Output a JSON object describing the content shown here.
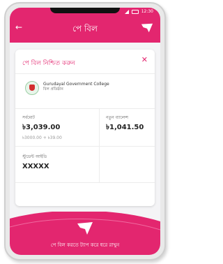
{
  "status_bar": {
    "time": "12:30"
  },
  "header": {
    "title": "পে বিল"
  },
  "confirm": {
    "title": "পে বিল নিশ্চিত করুন"
  },
  "biller": {
    "name": "Gurudayal Government College",
    "subtitle": "বিল প্রতিষ্ঠান"
  },
  "amount": {
    "label": "সর্বমোট",
    "value": "৳3,039.00",
    "breakdown": "৳3000.00 + ৳39.00"
  },
  "new_balance": {
    "label": "নতুন ব্যালেন্স",
    "value": "৳1,041.50"
  },
  "reference": {
    "label": "স্টুডেন্ট আইডি",
    "value": "XXXXX"
  },
  "footer": {
    "hint": "পে বিল করতে ট্যাপ করে ধরে রাখুন"
  },
  "colors": {
    "brand": "#e3266f",
    "card": "#ffffff",
    "background": "#f4f4f6"
  }
}
